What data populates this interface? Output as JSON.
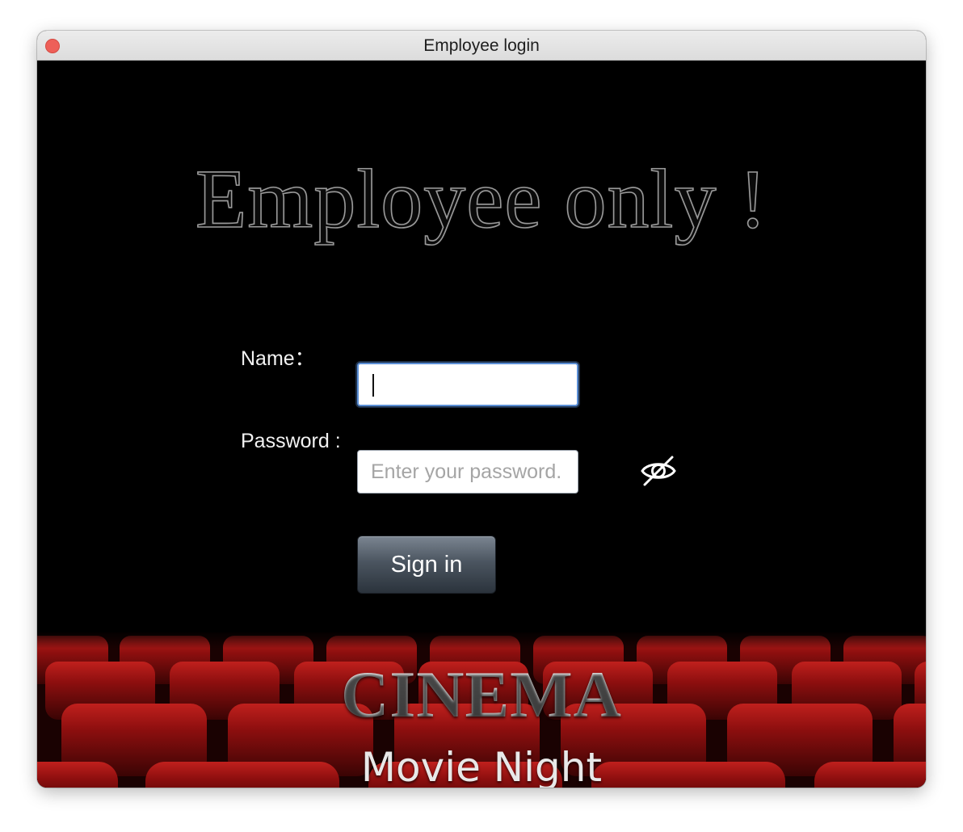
{
  "window": {
    "title": "Employee login"
  },
  "headline": "Employee only !",
  "form": {
    "name_label": "Name：",
    "name_value": "",
    "password_label": "Password :",
    "password_placeholder": "Enter your password.",
    "password_value": "",
    "toggle_icon": "eye-slash-icon",
    "signin_label": "Sign in"
  },
  "banner": {
    "title": "CINEMA",
    "subtitle": "Movie Night"
  },
  "colors": {
    "background": "#000000",
    "seat_red": "#8a0e0e",
    "button_top": "#7b8591",
    "button_bottom": "#2b333c",
    "focus_ring": "#5b8fd6"
  }
}
